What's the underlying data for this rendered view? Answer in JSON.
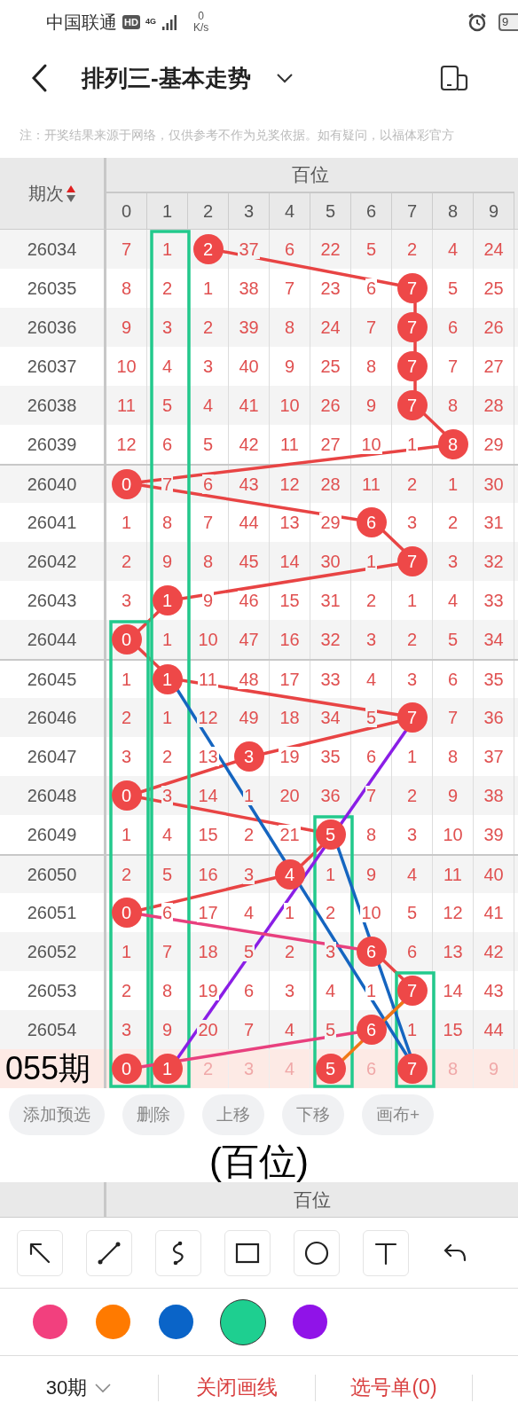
{
  "status_bar": {
    "carrier": "中国联通",
    "hd": "HD",
    "network": "4G",
    "speed_value": "0",
    "speed_unit": "K/s",
    "battery": "9"
  },
  "header": {
    "title": "排列三-基本走势"
  },
  "notice": "注：开奖结果来源于网络，仅供参考不作为兑奖依据。如有疑问，以福体彩官方",
  "table": {
    "period_header": "期次",
    "group_header": "百位",
    "columns": [
      "0",
      "1",
      "2",
      "3",
      "4",
      "5",
      "6",
      "7",
      "8",
      "9"
    ],
    "rows": [
      {
        "period": "26034",
        "cells": [
          {
            "v": "7",
            "hit": false
          },
          {
            "v": "1",
            "hit": false
          },
          {
            "v": "2",
            "hit": true
          },
          {
            "v": "37",
            "hit": false
          },
          {
            "v": "6",
            "hit": false
          },
          {
            "v": "22",
            "hit": false
          },
          {
            "v": "5",
            "hit": false
          },
          {
            "v": "2",
            "hit": false
          },
          {
            "v": "4",
            "hit": false
          },
          {
            "v": "24",
            "hit": false
          }
        ]
      },
      {
        "period": "26035",
        "cells": [
          {
            "v": "8",
            "hit": false
          },
          {
            "v": "2",
            "hit": false
          },
          {
            "v": "1",
            "hit": false
          },
          {
            "v": "38",
            "hit": false
          },
          {
            "v": "7",
            "hit": false
          },
          {
            "v": "23",
            "hit": false
          },
          {
            "v": "6",
            "hit": false
          },
          {
            "v": "7",
            "hit": true
          },
          {
            "v": "5",
            "hit": false
          },
          {
            "v": "25",
            "hit": false
          }
        ]
      },
      {
        "period": "26036",
        "cells": [
          {
            "v": "9",
            "hit": false
          },
          {
            "v": "3",
            "hit": false
          },
          {
            "v": "2",
            "hit": false
          },
          {
            "v": "39",
            "hit": false
          },
          {
            "v": "8",
            "hit": false
          },
          {
            "v": "24",
            "hit": false
          },
          {
            "v": "7",
            "hit": false
          },
          {
            "v": "7",
            "hit": true
          },
          {
            "v": "6",
            "hit": false
          },
          {
            "v": "26",
            "hit": false
          }
        ]
      },
      {
        "period": "26037",
        "cells": [
          {
            "v": "10",
            "hit": false
          },
          {
            "v": "4",
            "hit": false
          },
          {
            "v": "3",
            "hit": false
          },
          {
            "v": "40",
            "hit": false
          },
          {
            "v": "9",
            "hit": false
          },
          {
            "v": "25",
            "hit": false
          },
          {
            "v": "8",
            "hit": false
          },
          {
            "v": "7",
            "hit": true
          },
          {
            "v": "7",
            "hit": false
          },
          {
            "v": "27",
            "hit": false
          }
        ]
      },
      {
        "period": "26038",
        "cells": [
          {
            "v": "11",
            "hit": false
          },
          {
            "v": "5",
            "hit": false
          },
          {
            "v": "4",
            "hit": false
          },
          {
            "v": "41",
            "hit": false
          },
          {
            "v": "10",
            "hit": false
          },
          {
            "v": "26",
            "hit": false
          },
          {
            "v": "9",
            "hit": false
          },
          {
            "v": "7",
            "hit": true
          },
          {
            "v": "8",
            "hit": false
          },
          {
            "v": "28",
            "hit": false
          }
        ]
      },
      {
        "period": "26039",
        "cells": [
          {
            "v": "12",
            "hit": false
          },
          {
            "v": "6",
            "hit": false
          },
          {
            "v": "5",
            "hit": false
          },
          {
            "v": "42",
            "hit": false
          },
          {
            "v": "11",
            "hit": false
          },
          {
            "v": "27",
            "hit": false
          },
          {
            "v": "10",
            "hit": false
          },
          {
            "v": "1",
            "hit": false
          },
          {
            "v": "8",
            "hit": true
          },
          {
            "v": "29",
            "hit": false
          }
        ]
      },
      {
        "period": "26040",
        "cells": [
          {
            "v": "0",
            "hit": true
          },
          {
            "v": "7",
            "hit": false
          },
          {
            "v": "6",
            "hit": false
          },
          {
            "v": "43",
            "hit": false
          },
          {
            "v": "12",
            "hit": false
          },
          {
            "v": "28",
            "hit": false
          },
          {
            "v": "11",
            "hit": false
          },
          {
            "v": "2",
            "hit": false
          },
          {
            "v": "1",
            "hit": false
          },
          {
            "v": "30",
            "hit": false
          }
        ]
      },
      {
        "period": "26041",
        "cells": [
          {
            "v": "1",
            "hit": false
          },
          {
            "v": "8",
            "hit": false
          },
          {
            "v": "7",
            "hit": false
          },
          {
            "v": "44",
            "hit": false
          },
          {
            "v": "13",
            "hit": false
          },
          {
            "v": "29",
            "hit": false
          },
          {
            "v": "6",
            "hit": true
          },
          {
            "v": "3",
            "hit": false
          },
          {
            "v": "2",
            "hit": false
          },
          {
            "v": "31",
            "hit": false
          }
        ]
      },
      {
        "period": "26042",
        "cells": [
          {
            "v": "2",
            "hit": false
          },
          {
            "v": "9",
            "hit": false
          },
          {
            "v": "8",
            "hit": false
          },
          {
            "v": "45",
            "hit": false
          },
          {
            "v": "14",
            "hit": false
          },
          {
            "v": "30",
            "hit": false
          },
          {
            "v": "1",
            "hit": false
          },
          {
            "v": "7",
            "hit": true
          },
          {
            "v": "3",
            "hit": false
          },
          {
            "v": "32",
            "hit": false
          }
        ]
      },
      {
        "period": "26043",
        "cells": [
          {
            "v": "3",
            "hit": false
          },
          {
            "v": "1",
            "hit": true
          },
          {
            "v": "9",
            "hit": false
          },
          {
            "v": "46",
            "hit": false
          },
          {
            "v": "15",
            "hit": false
          },
          {
            "v": "31",
            "hit": false
          },
          {
            "v": "2",
            "hit": false
          },
          {
            "v": "1",
            "hit": false
          },
          {
            "v": "4",
            "hit": false
          },
          {
            "v": "33",
            "hit": false
          }
        ]
      },
      {
        "period": "26044",
        "cells": [
          {
            "v": "0",
            "hit": true
          },
          {
            "v": "1",
            "hit": false
          },
          {
            "v": "10",
            "hit": false
          },
          {
            "v": "47",
            "hit": false
          },
          {
            "v": "16",
            "hit": false
          },
          {
            "v": "32",
            "hit": false
          },
          {
            "v": "3",
            "hit": false
          },
          {
            "v": "2",
            "hit": false
          },
          {
            "v": "5",
            "hit": false
          },
          {
            "v": "34",
            "hit": false
          }
        ]
      },
      {
        "period": "26045",
        "cells": [
          {
            "v": "1",
            "hit": false
          },
          {
            "v": "1",
            "hit": true
          },
          {
            "v": "11",
            "hit": false
          },
          {
            "v": "48",
            "hit": false
          },
          {
            "v": "17",
            "hit": false
          },
          {
            "v": "33",
            "hit": false
          },
          {
            "v": "4",
            "hit": false
          },
          {
            "v": "3",
            "hit": false
          },
          {
            "v": "6",
            "hit": false
          },
          {
            "v": "35",
            "hit": false
          }
        ]
      },
      {
        "period": "26046",
        "cells": [
          {
            "v": "2",
            "hit": false
          },
          {
            "v": "1",
            "hit": false
          },
          {
            "v": "12",
            "hit": false
          },
          {
            "v": "49",
            "hit": false
          },
          {
            "v": "18",
            "hit": false
          },
          {
            "v": "34",
            "hit": false
          },
          {
            "v": "5",
            "hit": false
          },
          {
            "v": "7",
            "hit": true
          },
          {
            "v": "7",
            "hit": false
          },
          {
            "v": "36",
            "hit": false
          }
        ]
      },
      {
        "period": "26047",
        "cells": [
          {
            "v": "3",
            "hit": false
          },
          {
            "v": "2",
            "hit": false
          },
          {
            "v": "13",
            "hit": false
          },
          {
            "v": "3",
            "hit": true
          },
          {
            "v": "19",
            "hit": false
          },
          {
            "v": "35",
            "hit": false
          },
          {
            "v": "6",
            "hit": false
          },
          {
            "v": "1",
            "hit": false
          },
          {
            "v": "8",
            "hit": false
          },
          {
            "v": "37",
            "hit": false
          }
        ]
      },
      {
        "period": "26048",
        "cells": [
          {
            "v": "0",
            "hit": true
          },
          {
            "v": "3",
            "hit": false
          },
          {
            "v": "14",
            "hit": false
          },
          {
            "v": "1",
            "hit": false
          },
          {
            "v": "20",
            "hit": false
          },
          {
            "v": "36",
            "hit": false
          },
          {
            "v": "7",
            "hit": false
          },
          {
            "v": "2",
            "hit": false
          },
          {
            "v": "9",
            "hit": false
          },
          {
            "v": "38",
            "hit": false
          }
        ]
      },
      {
        "period": "26049",
        "cells": [
          {
            "v": "1",
            "hit": false
          },
          {
            "v": "4",
            "hit": false
          },
          {
            "v": "15",
            "hit": false
          },
          {
            "v": "2",
            "hit": false
          },
          {
            "v": "21",
            "hit": false
          },
          {
            "v": "5",
            "hit": true
          },
          {
            "v": "8",
            "hit": false
          },
          {
            "v": "3",
            "hit": false
          },
          {
            "v": "10",
            "hit": false
          },
          {
            "v": "39",
            "hit": false
          }
        ]
      },
      {
        "period": "26050",
        "cells": [
          {
            "v": "2",
            "hit": false
          },
          {
            "v": "5",
            "hit": false
          },
          {
            "v": "16",
            "hit": false
          },
          {
            "v": "3",
            "hit": false
          },
          {
            "v": "4",
            "hit": true
          },
          {
            "v": "1",
            "hit": false
          },
          {
            "v": "9",
            "hit": false
          },
          {
            "v": "4",
            "hit": false
          },
          {
            "v": "11",
            "hit": false
          },
          {
            "v": "40",
            "hit": false
          }
        ]
      },
      {
        "period": "26051",
        "cells": [
          {
            "v": "0",
            "hit": true
          },
          {
            "v": "6",
            "hit": false
          },
          {
            "v": "17",
            "hit": false
          },
          {
            "v": "4",
            "hit": false
          },
          {
            "v": "1",
            "hit": false
          },
          {
            "v": "2",
            "hit": false
          },
          {
            "v": "10",
            "hit": false
          },
          {
            "v": "5",
            "hit": false
          },
          {
            "v": "12",
            "hit": false
          },
          {
            "v": "41",
            "hit": false
          }
        ]
      },
      {
        "period": "26052",
        "cells": [
          {
            "v": "1",
            "hit": false
          },
          {
            "v": "7",
            "hit": false
          },
          {
            "v": "18",
            "hit": false
          },
          {
            "v": "5",
            "hit": false
          },
          {
            "v": "2",
            "hit": false
          },
          {
            "v": "3",
            "hit": false
          },
          {
            "v": "6",
            "hit": true
          },
          {
            "v": "6",
            "hit": false
          },
          {
            "v": "13",
            "hit": false
          },
          {
            "v": "42",
            "hit": false
          }
        ]
      },
      {
        "period": "26053",
        "cells": [
          {
            "v": "2",
            "hit": false
          },
          {
            "v": "8",
            "hit": false
          },
          {
            "v": "19",
            "hit": false
          },
          {
            "v": "6",
            "hit": false
          },
          {
            "v": "3",
            "hit": false
          },
          {
            "v": "4",
            "hit": false
          },
          {
            "v": "1",
            "hit": false
          },
          {
            "v": "7",
            "hit": true
          },
          {
            "v": "14",
            "hit": false
          },
          {
            "v": "43",
            "hit": false
          }
        ]
      },
      {
        "period": "26054",
        "cells": [
          {
            "v": "3",
            "hit": false
          },
          {
            "v": "9",
            "hit": false
          },
          {
            "v": "20",
            "hit": false
          },
          {
            "v": "7",
            "hit": false
          },
          {
            "v": "4",
            "hit": false
          },
          {
            "v": "5",
            "hit": false
          },
          {
            "v": "6",
            "hit": true
          },
          {
            "v": "1",
            "hit": false
          },
          {
            "v": "15",
            "hit": false
          },
          {
            "v": "44",
            "hit": false
          }
        ]
      }
    ],
    "preview_row": {
      "label": "055期",
      "cells": [
        {
          "v": "0",
          "picked": true
        },
        {
          "v": "1",
          "picked": true
        },
        {
          "v": "2",
          "picked": false
        },
        {
          "v": "3",
          "picked": false
        },
        {
          "v": "4",
          "picked": false
        },
        {
          "v": "5",
          "picked": true
        },
        {
          "v": "6",
          "picked": false
        },
        {
          "v": "7",
          "picked": true
        },
        {
          "v": "8",
          "picked": false
        },
        {
          "v": "9",
          "picked": false
        }
      ]
    }
  },
  "drawn_text": "(百位)",
  "actions": [
    "添加预选",
    "删除",
    "上移",
    "下移",
    "画布+"
  ],
  "footer_header": "百位",
  "tools": [
    {
      "kind": "arrow"
    },
    {
      "kind": "line"
    },
    {
      "kind": "curve"
    },
    {
      "kind": "rect"
    },
    {
      "kind": "circle"
    },
    {
      "kind": "text"
    },
    {
      "kind": "undo"
    }
  ],
  "palette": [
    {
      "color": "#f2407e",
      "selected": false
    },
    {
      "color": "#ff7a00",
      "selected": false
    },
    {
      "color": "#0a64c8",
      "selected": false
    },
    {
      "color": "#1ecf90",
      "selected": true
    },
    {
      "color": "#9013e8",
      "selected": false
    }
  ],
  "bottom_bar": {
    "period_select": "30期",
    "actions": [
      "关闭画线",
      "选号单(0)"
    ]
  }
}
